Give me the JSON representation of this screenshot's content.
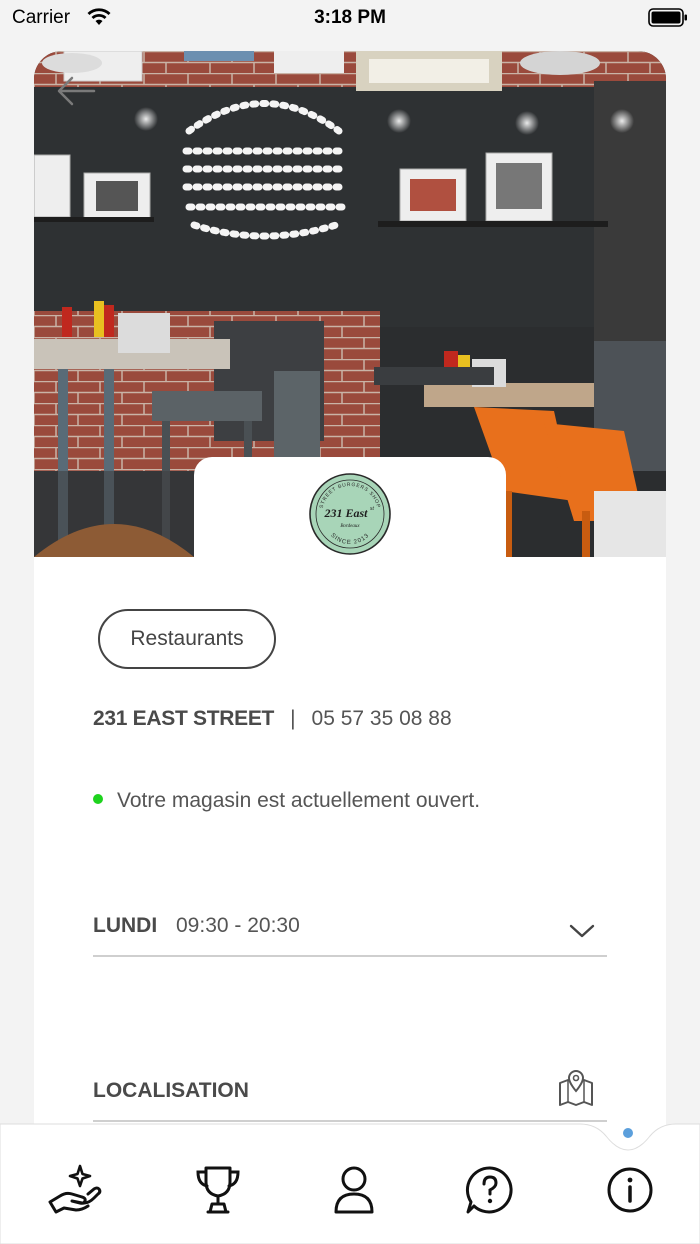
{
  "status_bar": {
    "carrier": "Carrier",
    "time": "3:18 PM"
  },
  "store": {
    "category": "Restaurants",
    "name": "231 EAST STREET",
    "separator": "|",
    "phone": "05 57 35 08 88",
    "open_status": "Votre magasin est actuellement ouvert.",
    "logo": {
      "lines": [
        "STREET BURGERS SHOP",
        "231 East",
        "st",
        "Bordeaux",
        "SINCE 2013"
      ]
    },
    "hours": {
      "day": "LUNDI",
      "time": "09:30 - 20:30"
    },
    "location_label": "LOCALISATION"
  },
  "colors": {
    "open_dot": "#1ed31e",
    "active_nav": "#5b9fdc",
    "logo_bg": "#a8d5b8"
  },
  "nav": [
    {
      "icon": "hand-sparkle-icon",
      "active": false
    },
    {
      "icon": "trophy-icon",
      "active": false
    },
    {
      "icon": "user-icon",
      "active": false
    },
    {
      "icon": "help-bubble-icon",
      "active": false
    },
    {
      "icon": "info-icon",
      "active": true
    }
  ]
}
